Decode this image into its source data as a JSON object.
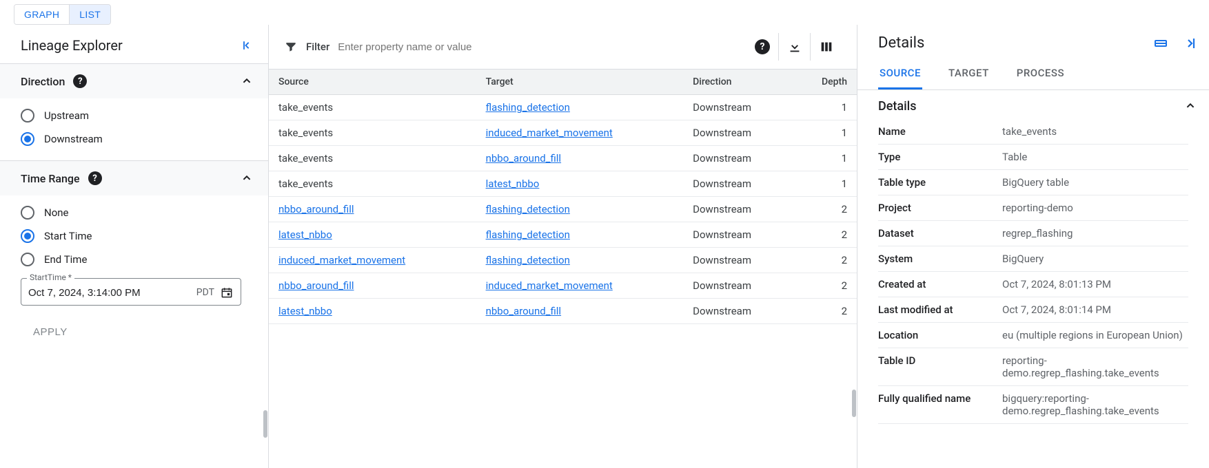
{
  "topTabs": {
    "graph": "GRAPH",
    "list": "LIST"
  },
  "sidebar": {
    "title": "Lineage Explorer",
    "direction": {
      "title": "Direction",
      "options": {
        "upstream": "Upstream",
        "downstream": "Downstream"
      },
      "selected": "downstream"
    },
    "timeRange": {
      "title": "Time Range",
      "options": {
        "none": "None",
        "start": "Start Time",
        "end": "End Time"
      },
      "selected": "start",
      "startTimeLabel": "StartTime *",
      "startTimeValue": "Oct 7, 2024, 3:14:00 PM",
      "tz": "PDT"
    },
    "apply": "APPLY"
  },
  "filter": {
    "label": "Filter",
    "placeholder": "Enter property name or value"
  },
  "table": {
    "headers": {
      "source": "Source",
      "target": "Target",
      "direction": "Direction",
      "depth": "Depth"
    },
    "rows": [
      {
        "source": "take_events",
        "sourceLink": false,
        "target": "flashing_detection",
        "direction": "Downstream",
        "depth": "1"
      },
      {
        "source": "take_events",
        "sourceLink": false,
        "target": "induced_market_movement",
        "direction": "Downstream",
        "depth": "1"
      },
      {
        "source": "take_events",
        "sourceLink": false,
        "target": "nbbo_around_fill",
        "direction": "Downstream",
        "depth": "1"
      },
      {
        "source": "take_events",
        "sourceLink": false,
        "target": "latest_nbbo",
        "direction": "Downstream",
        "depth": "1"
      },
      {
        "source": "nbbo_around_fill",
        "sourceLink": true,
        "target": "flashing_detection",
        "direction": "Downstream",
        "depth": "2"
      },
      {
        "source": "latest_nbbo",
        "sourceLink": true,
        "target": "flashing_detection",
        "direction": "Downstream",
        "depth": "2"
      },
      {
        "source": "induced_market_movement",
        "sourceLink": true,
        "target": "flashing_detection",
        "direction": "Downstream",
        "depth": "2"
      },
      {
        "source": "nbbo_around_fill",
        "sourceLink": true,
        "target": "induced_market_movement",
        "direction": "Downstream",
        "depth": "2"
      },
      {
        "source": "latest_nbbo",
        "sourceLink": true,
        "target": "nbbo_around_fill",
        "direction": "Downstream",
        "depth": "2"
      }
    ]
  },
  "details": {
    "title": "Details",
    "tabs": {
      "source": "SOURCE",
      "target": "TARGET",
      "process": "PROCESS"
    },
    "subTitle": "Details",
    "props": [
      {
        "key": "Name",
        "val": "take_events"
      },
      {
        "key": "Type",
        "val": "Table"
      },
      {
        "key": "Table type",
        "val": "BigQuery table"
      },
      {
        "key": "Project",
        "val": "reporting-demo"
      },
      {
        "key": "Dataset",
        "val": "regrep_flashing"
      },
      {
        "key": "System",
        "val": "BigQuery"
      },
      {
        "key": "Created at",
        "val": "Oct 7, 2024, 8:01:13 PM"
      },
      {
        "key": "Last modified at",
        "val": "Oct 7, 2024, 8:01:14 PM"
      },
      {
        "key": "Location",
        "val": "eu (multiple regions in European Union)"
      },
      {
        "key": "Table ID",
        "val": "reporting-demo.regrep_flashing.take_events"
      },
      {
        "key": "Fully qualified name",
        "val": "bigquery:reporting-demo.regrep_flashing.take_events"
      }
    ]
  }
}
